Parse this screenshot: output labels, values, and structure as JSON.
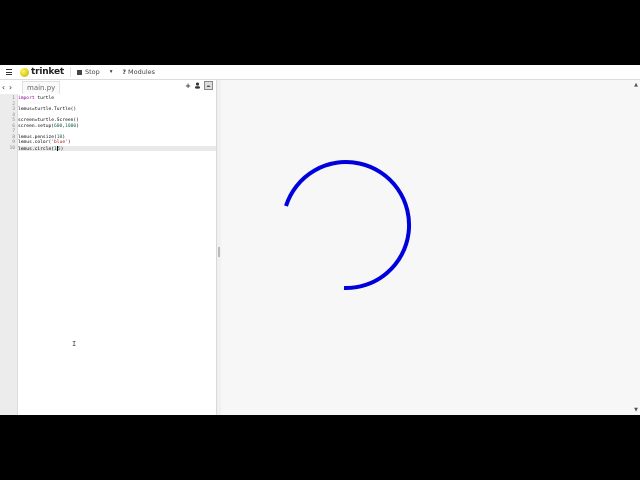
{
  "toolbar": {
    "brand": "trinket",
    "stop_label": "Stop",
    "caret": "▾",
    "modules_label": "Modules",
    "modules_icon": "?"
  },
  "editor": {
    "nav_back": "‹",
    "nav_forward": "›",
    "file_tab": "main.py",
    "add_icon": "+",
    "user_icon": "person-icon",
    "image_icon": "image-icon",
    "lines": [
      {
        "num": "1",
        "tokens": [
          {
            "t": "import",
            "c": "k"
          },
          {
            "t": " turtle",
            "c": ""
          }
        ]
      },
      {
        "num": "2",
        "tokens": []
      },
      {
        "num": "3",
        "tokens": [
          {
            "t": "lemus",
            "c": ""
          },
          {
            "t": "=",
            "c": ""
          },
          {
            "t": "turtle",
            "c": ""
          },
          {
            "t": ".",
            "c": ""
          },
          {
            "t": "Turtle",
            "c": ""
          },
          {
            "t": "()",
            "c": ""
          }
        ]
      },
      {
        "num": "4",
        "tokens": []
      },
      {
        "num": "5",
        "tokens": [
          {
            "t": "screen",
            "c": ""
          },
          {
            "t": "=",
            "c": ""
          },
          {
            "t": "turtle",
            "c": ""
          },
          {
            "t": ".",
            "c": ""
          },
          {
            "t": "Screen",
            "c": ""
          },
          {
            "t": "()",
            "c": ""
          }
        ]
      },
      {
        "num": "6",
        "tokens": [
          {
            "t": "screen",
            "c": ""
          },
          {
            "t": ".",
            "c": ""
          },
          {
            "t": "setup",
            "c": ""
          },
          {
            "t": "(",
            "c": ""
          },
          {
            "t": "600",
            "c": "n"
          },
          {
            "t": ",",
            "c": ""
          },
          {
            "t": "1000",
            "c": "n"
          },
          {
            "t": ")",
            "c": ""
          }
        ]
      },
      {
        "num": "7",
        "tokens": []
      },
      {
        "num": "8",
        "tokens": [
          {
            "t": "lemus",
            "c": ""
          },
          {
            "t": ".",
            "c": ""
          },
          {
            "t": "pensize",
            "c": ""
          },
          {
            "t": "(",
            "c": ""
          },
          {
            "t": "10",
            "c": "n"
          },
          {
            "t": ")",
            "c": ""
          }
        ]
      },
      {
        "num": "9",
        "tokens": [
          {
            "t": "lemus",
            "c": ""
          },
          {
            "t": ".",
            "c": ""
          },
          {
            "t": "color",
            "c": ""
          },
          {
            "t": "(",
            "c": ""
          },
          {
            "t": "'blue'",
            "c": "s"
          },
          {
            "t": ")",
            "c": ""
          }
        ]
      },
      {
        "num": "10",
        "tokens": [
          {
            "t": "lemus",
            "c": ""
          },
          {
            "t": ".",
            "c": ""
          },
          {
            "t": "circle",
            "c": ""
          },
          {
            "t": "(",
            "c": ""
          },
          {
            "t": "15",
            "c": "n"
          },
          {
            "t": ")",
            "c": ""
          }
        ]
      }
    ],
    "active_line": 10,
    "mouse_cursor": "I"
  },
  "canvas": {
    "stroke_color": "#0000dd",
    "stroke_width": 10,
    "scroll_up": "▲",
    "scroll_down": "▼"
  },
  "colors": {
    "background": "#f7f7f7",
    "gutter": "#ececec",
    "active_line": "#e9e9e9"
  }
}
